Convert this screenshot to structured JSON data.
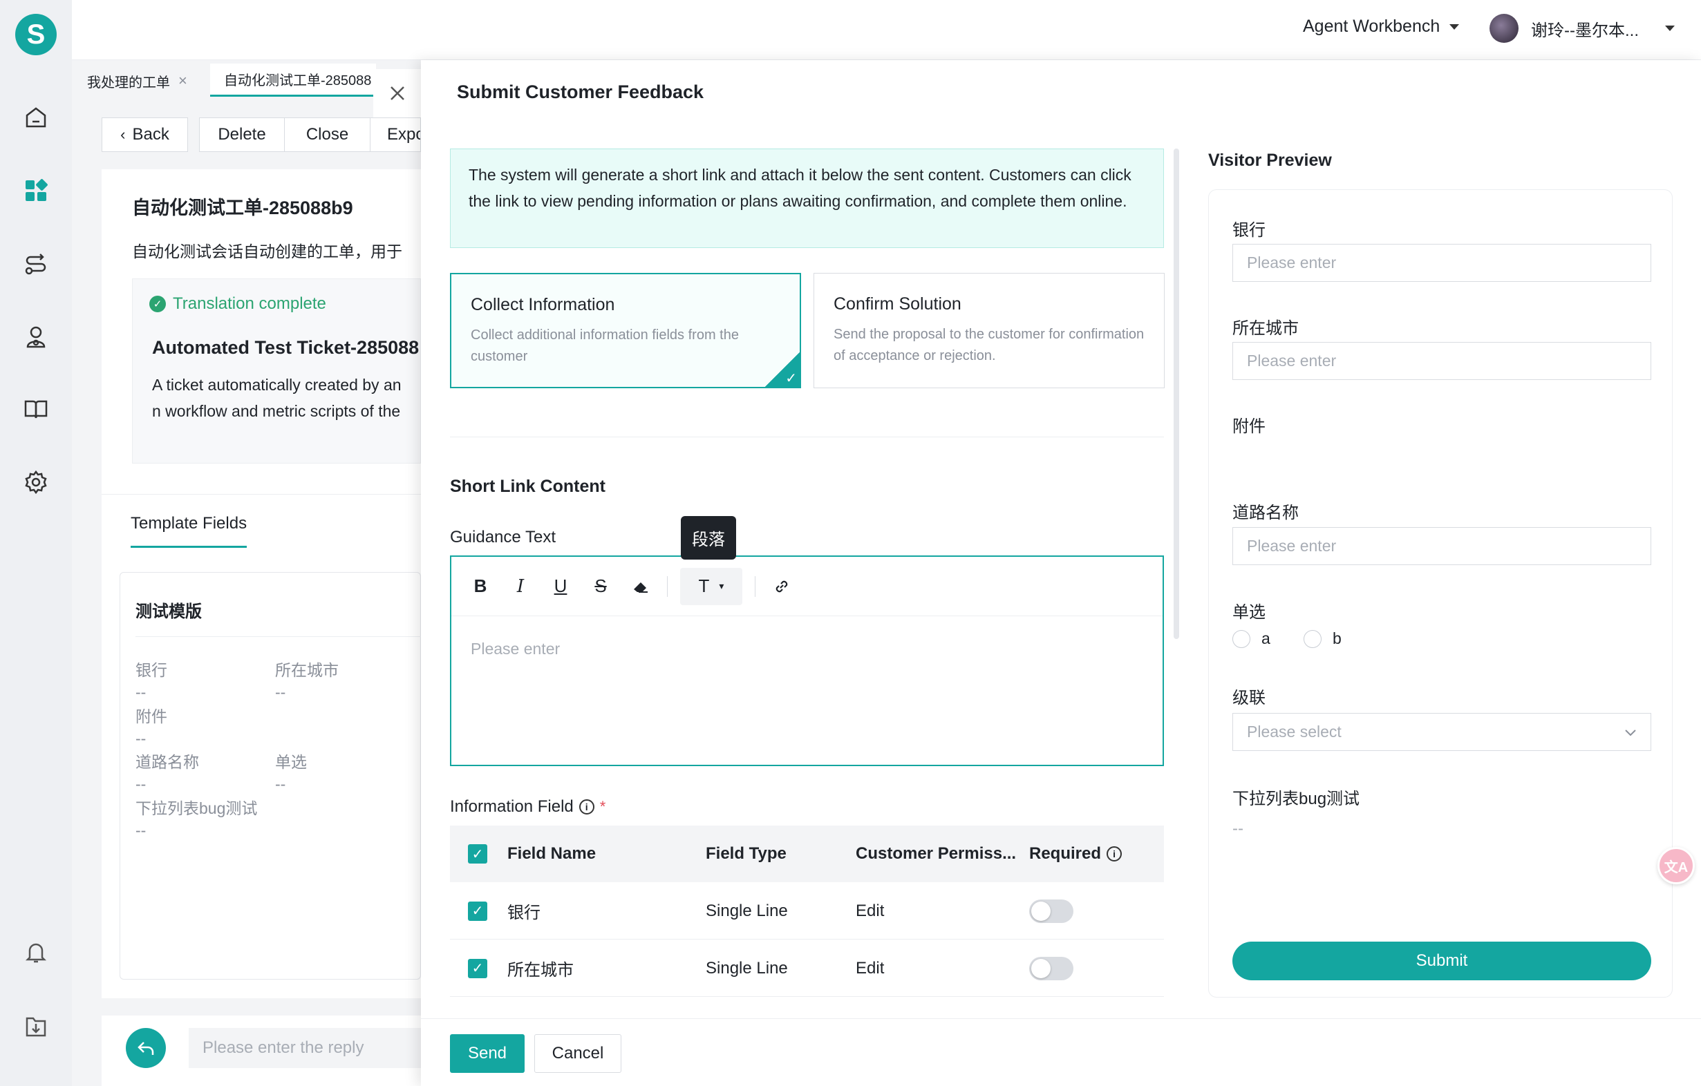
{
  "brand": {
    "logo_letter": "S",
    "accent": "#14a6a0"
  },
  "topbar": {
    "workspace": "Agent Workbench",
    "user_name": "谢玲--墨尔本..."
  },
  "tabs": [
    {
      "label": "我处理的工单"
    },
    {
      "label": "自动化测试工单-285088"
    }
  ],
  "ticket_actions": {
    "back": "Back",
    "delete": "Delete",
    "close": "Close",
    "export": "Expo"
  },
  "ticket": {
    "title": "自动化测试工单-285088b9",
    "desc": "自动化测试会话自动创建的工单，用于",
    "translation_status": "Translation complete",
    "en_title": "Automated Test Ticket-285088",
    "en_desc_line1": "A ticket automatically created by an",
    "en_desc_line2": "n workflow and metric scripts of the"
  },
  "template_fields": {
    "tab_label": "Template Fields",
    "template_name": "测试模版",
    "fields": [
      {
        "label": "银行",
        "value": "--"
      },
      {
        "label": "所在城市",
        "value": "--"
      },
      {
        "label": "附件",
        "value": "--"
      },
      {
        "label": "道路名称",
        "value": "--"
      },
      {
        "label": "单选",
        "value": "--"
      },
      {
        "label": "下拉列表bug测试",
        "value": "--"
      }
    ]
  },
  "reply": {
    "placeholder": "Please enter the reply"
  },
  "modal": {
    "title": "Submit Customer Feedback",
    "notice": "The system will generate a short link and attach it below the sent content. Customers can click the link to view pending information or plans awaiting confirmation, and complete them online.",
    "modes": [
      {
        "title": "Collect Information",
        "desc": "Collect additional information fields from the customer",
        "selected": true
      },
      {
        "title": "Confirm Solution",
        "desc": "Send the proposal to the customer for confirmation of acceptance or rejection.",
        "selected": false
      }
    ],
    "short_link_heading": "Short Link Content",
    "guidance_label": "Guidance Text",
    "tooltip": "段落",
    "editor_placeholder": "Please enter",
    "info_field_label": "Information Field",
    "table": {
      "headers": {
        "field_name": "Field Name",
        "field_type": "Field Type",
        "permission": "Customer Permiss...",
        "required": "Required"
      },
      "rows": [
        {
          "name": "银行",
          "type": "Single Line",
          "permission": "Edit",
          "required": false
        },
        {
          "name": "所在城市",
          "type": "Single Line",
          "permission": "Edit",
          "required": false
        }
      ]
    },
    "send": "Send",
    "cancel": "Cancel"
  },
  "preview": {
    "heading": "Visitor Preview",
    "bank_label": "银行",
    "bank_placeholder": "Please enter",
    "city_label": "所在城市",
    "city_placeholder": "Please enter",
    "attachment_label": "附件",
    "road_label": "道路名称",
    "road_placeholder": "Please enter",
    "radio_label": "单选",
    "radio_a": "a",
    "radio_b": "b",
    "cascade_label": "级联",
    "cascade_placeholder": "Please select",
    "dropdown_label": "下拉列表bug测试",
    "dropdown_value": "--",
    "submit": "Submit"
  },
  "icons": [
    "home-icon",
    "dashboard-icon",
    "routing-icon",
    "contacts-icon",
    "knowledge-book-icon",
    "settings-gear-icon",
    "bell-icon",
    "download-icon",
    "translate-icon"
  ]
}
